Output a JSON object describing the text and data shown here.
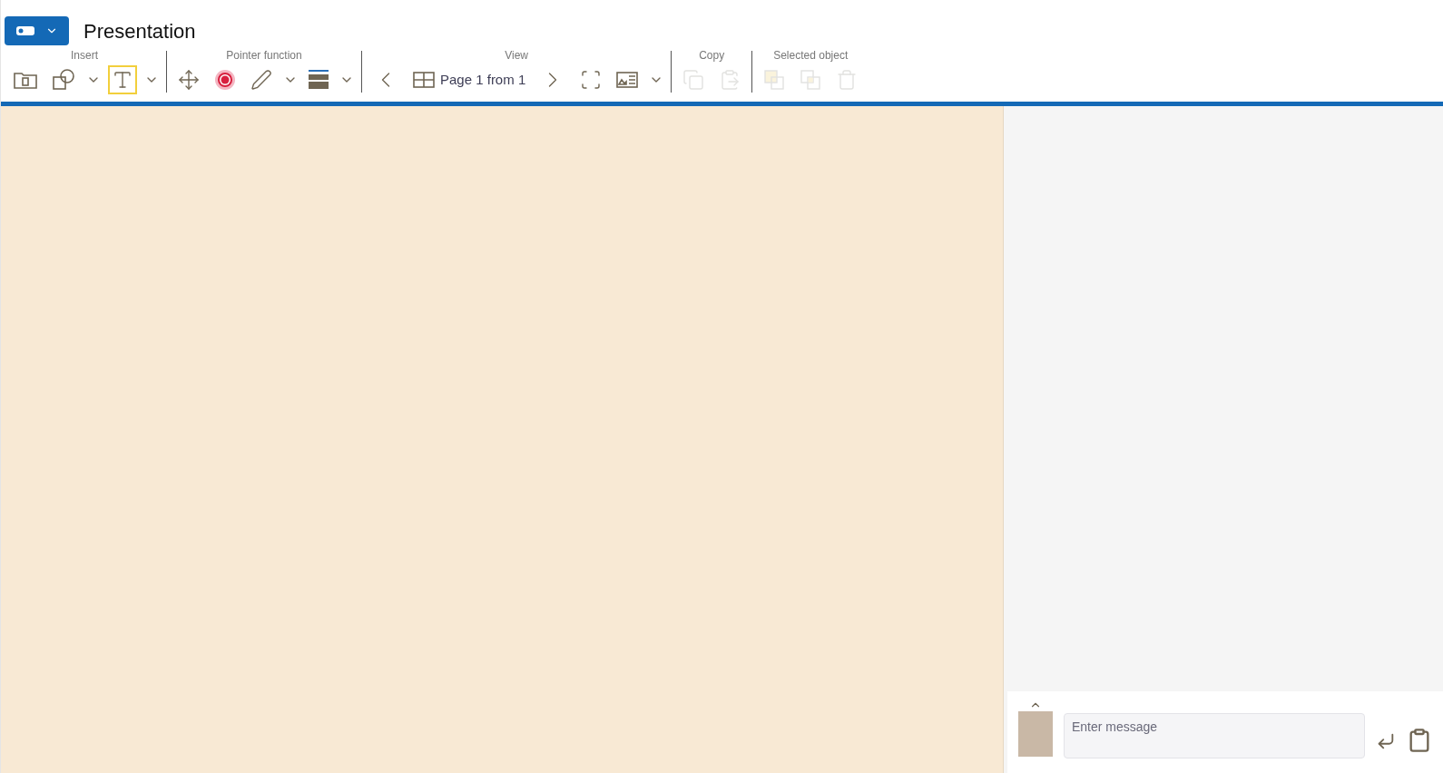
{
  "title": "Presentation",
  "toolbar": [
    {
      "label": "Insert",
      "tools": [
        {
          "kind": "folder",
          "selected": false,
          "disabled": false
        },
        {
          "kind": "shapes",
          "selected": false,
          "disabled": false
        },
        {
          "kind": "dropdown"
        },
        {
          "kind": "text",
          "selected": true,
          "disabled": false
        },
        {
          "kind": "dropdown"
        }
      ]
    },
    {
      "label": "Pointer function",
      "tools": [
        {
          "kind": "move",
          "selected": false,
          "disabled": false
        },
        {
          "kind": "pointer",
          "selected": false,
          "disabled": false
        },
        {
          "kind": "pen",
          "selected": false,
          "disabled": false
        },
        {
          "kind": "dropdown"
        },
        {
          "kind": "line-width",
          "selected": false,
          "disabled": false
        },
        {
          "kind": "dropdown"
        }
      ]
    },
    {
      "label": "View",
      "tools": [
        {
          "kind": "prev",
          "selected": false,
          "disabled": false
        },
        {
          "kind": "pages",
          "label": "Page 1 from 1",
          "selected": false,
          "disabled": false
        },
        {
          "kind": "next",
          "selected": false,
          "disabled": false
        },
        {
          "kind": "fullscreen",
          "selected": false,
          "disabled": false
        },
        {
          "kind": "layout",
          "selected": false,
          "disabled": false
        },
        {
          "kind": "dropdown"
        }
      ]
    },
    {
      "label": "Copy",
      "tools": [
        {
          "kind": "copy",
          "selected": false,
          "disabled": true
        },
        {
          "kind": "paste",
          "selected": false,
          "disabled": true
        }
      ]
    },
    {
      "label": "Selected object",
      "tools": [
        {
          "kind": "front",
          "selected": false,
          "disabled": true
        },
        {
          "kind": "back",
          "selected": false,
          "disabled": true
        },
        {
          "kind": "delete",
          "selected": false,
          "disabled": true
        }
      ]
    }
  ],
  "chat": {
    "placeholder": "Enter message"
  }
}
